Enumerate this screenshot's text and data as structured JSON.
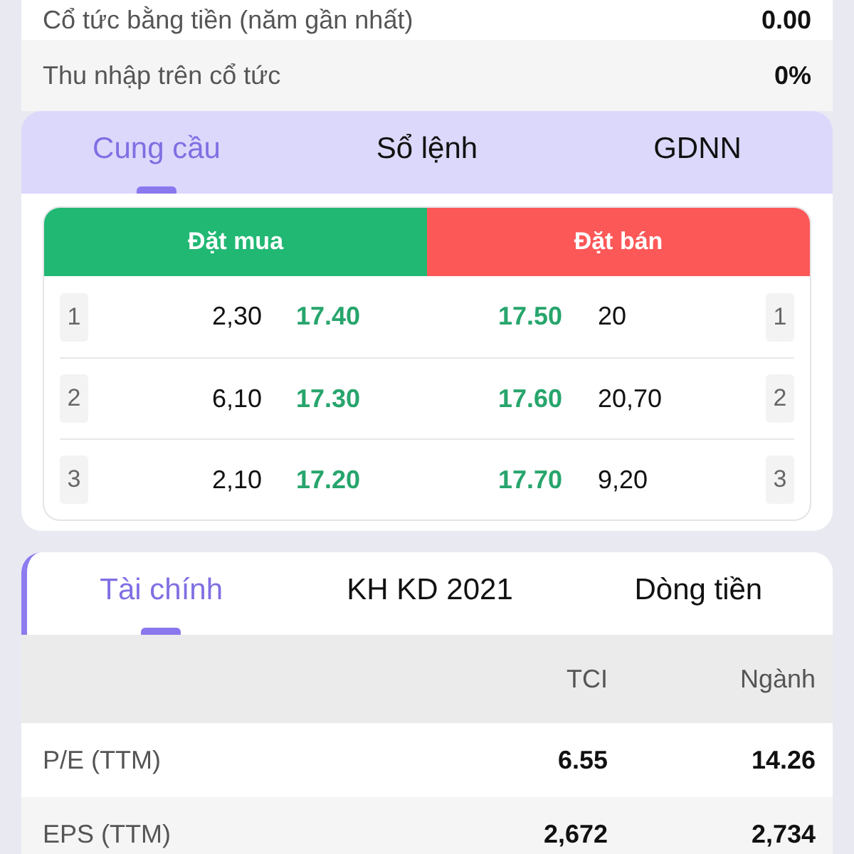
{
  "dividend_rows": [
    {
      "label": "Cổ tức bằng tiền (năm gần nhất)",
      "value": "0.00"
    },
    {
      "label": "Thu nhập trên cổ tức",
      "value": "0%"
    }
  ],
  "order_book": {
    "tabs": [
      {
        "label": "Cung cầu",
        "selected": true
      },
      {
        "label": "Sổ lệnh",
        "selected": false
      },
      {
        "label": "GDNN",
        "selected": false
      }
    ],
    "sides": [
      {
        "label": "Đặt mua",
        "kind": "buy"
      },
      {
        "label": "Đặt bán",
        "kind": "sell"
      }
    ],
    "rows": [
      {
        "bid_level": "1",
        "bid_volume": "2,30",
        "bid_price": "17.40",
        "ask_price": "17.50",
        "ask_volume": "20",
        "ask_level": "1"
      },
      {
        "bid_level": "2",
        "bid_volume": "6,10",
        "bid_price": "17.30",
        "ask_price": "17.60",
        "ask_volume": "20,70",
        "ask_level": "2"
      },
      {
        "bid_level": "3",
        "bid_volume": "2,10",
        "bid_price": "17.20",
        "ask_price": "17.70",
        "ask_volume": "9,20",
        "ask_level": "3"
      }
    ]
  },
  "financials": {
    "tabs": [
      {
        "label": "Tài chính",
        "selected": true
      },
      {
        "label": "KH KD 2021",
        "selected": false
      },
      {
        "label": "Dòng tiền",
        "selected": false
      }
    ],
    "columns": [
      "TCI",
      "Ngành"
    ],
    "rows": [
      {
        "label": "P/E (TTM)",
        "values": [
          "6.55",
          "14.26"
        ]
      },
      {
        "label": "EPS (TTM)",
        "values": [
          "2,672",
          "2,734"
        ]
      }
    ]
  }
}
